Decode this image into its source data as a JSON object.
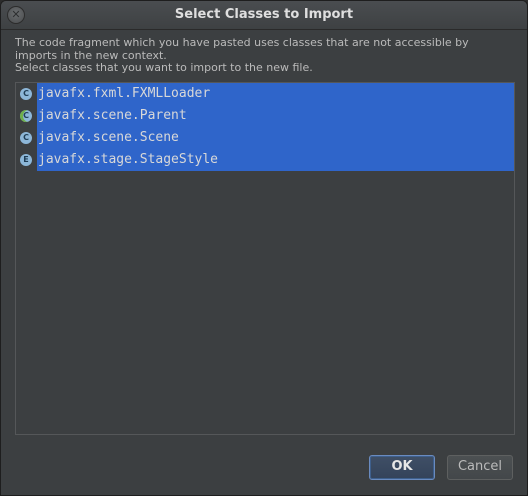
{
  "dialog": {
    "title": "Select Classes to Import",
    "close_glyph": "✕",
    "message_lines": [
      "The code fragment which you have pasted uses classes that are not accessible by",
      "imports in the new context.",
      "Select classes that you want to import to the new file."
    ]
  },
  "classes": [
    {
      "name": "javafx.fxml.FXMLLoader",
      "kind": "class",
      "badge": "C"
    },
    {
      "name": "javafx.scene.Parent",
      "kind": "abstract-class",
      "badge": "C"
    },
    {
      "name": "javafx.scene.Scene",
      "kind": "class",
      "badge": "C"
    },
    {
      "name": "javafx.stage.StageStyle",
      "kind": "enum",
      "badge": "E"
    }
  ],
  "buttons": {
    "ok_label": "OK",
    "cancel_label": "Cancel"
  },
  "colors": {
    "selection": "#2f65ca",
    "background": "#3c3f41",
    "text": "#bbbbbb"
  }
}
